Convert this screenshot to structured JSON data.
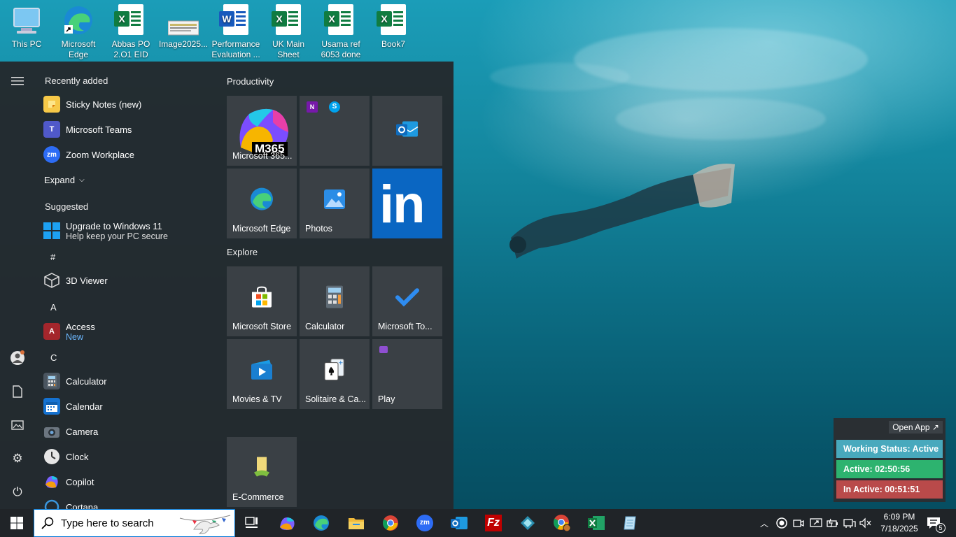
{
  "desktop": {
    "icons": [
      {
        "label": "This PC"
      },
      {
        "label": "Microsoft Edge"
      },
      {
        "label": "Abbas PO 2.O1  EID"
      },
      {
        "label": "Image2025..."
      },
      {
        "label": "Performance Evaluation ..."
      },
      {
        "label": "UK Main Sheet"
      },
      {
        "label": "Usama ref 6053 done"
      },
      {
        "label": "Book7"
      }
    ]
  },
  "start_menu": {
    "recently_added": "Recently added",
    "recent_apps": [
      "Sticky Notes (new)",
      "Microsoft Teams",
      "Zoom Workplace"
    ],
    "expand": "Expand",
    "suggested": "Suggested",
    "suggestion_title": "Upgrade to Windows 11",
    "suggestion_sub": "Help keep your PC secure",
    "letters": {
      "hash": "#",
      "a": "A",
      "c": "C"
    },
    "apps": {
      "viewer3d": "3D Viewer",
      "access": "Access",
      "access_new": "New",
      "calculator": "Calculator",
      "calendar": "Calendar",
      "camera": "Camera",
      "clock": "Clock",
      "copilot": "Copilot",
      "cortana": "Cortana"
    },
    "groups": {
      "productivity": "Productivity",
      "explore": "Explore"
    },
    "tiles": {
      "m365": "Microsoft 365...",
      "m365_badge": "M365",
      "edge": "Microsoft Edge",
      "photos": "Photos",
      "store": "Microsoft Store",
      "calculator": "Calculator",
      "todo": "Microsoft To...",
      "movies": "Movies & TV",
      "solitaire": "Solitaire & Ca...",
      "play": "Play",
      "ecommerce": "E-Commerce"
    }
  },
  "widget": {
    "open_app": "Open App ↗",
    "status": "Working Status: Active",
    "active": "Active: 02:50:56",
    "inactive": "In Active: 00:51:51",
    "colors": {
      "status": "#48a9bd",
      "active": "#2db36f",
      "inactive": "#b94a4a"
    }
  },
  "taskbar": {
    "search_placeholder": "Type here to search",
    "time": "6:09 PM",
    "date": "7/18/2025",
    "notification_count": "5"
  }
}
